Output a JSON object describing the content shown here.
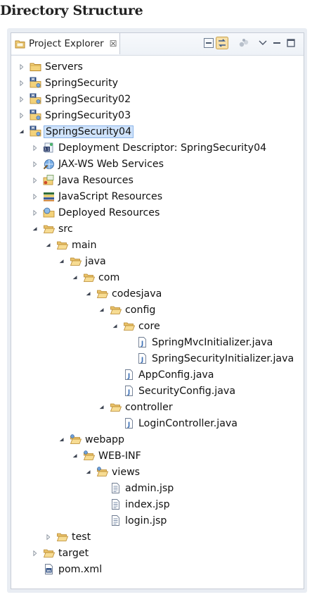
{
  "heading": "Directory Structure",
  "view": {
    "tab_label": "Project Explorer",
    "close_glyph": "☒"
  },
  "tree": [
    {
      "depth": 0,
      "label": "Servers",
      "icon": "folder-icon",
      "twisty": "collapsed"
    },
    {
      "depth": 0,
      "label": "SpringSecurity",
      "icon": "maven-web-project-icon",
      "twisty": "collapsed"
    },
    {
      "depth": 0,
      "label": "SpringSecurity02",
      "icon": "maven-web-project-icon",
      "twisty": "collapsed"
    },
    {
      "depth": 0,
      "label": "SpringSecurity03",
      "icon": "maven-web-project-icon",
      "twisty": "collapsed"
    },
    {
      "depth": 0,
      "label": "SpringSecurity04",
      "icon": "maven-web-project-icon",
      "twisty": "expanded",
      "selected": true
    },
    {
      "depth": 1,
      "label": "Deployment Descriptor: SpringSecurity04",
      "icon": "deployment-descriptor-icon",
      "twisty": "collapsed"
    },
    {
      "depth": 1,
      "label": "JAX-WS Web Services",
      "icon": "web-services-icon",
      "twisty": "collapsed"
    },
    {
      "depth": 1,
      "label": "Java Resources",
      "icon": "java-resources-icon",
      "twisty": "collapsed"
    },
    {
      "depth": 1,
      "label": "JavaScript Resources",
      "icon": "javascript-resources-icon",
      "twisty": "collapsed"
    },
    {
      "depth": 1,
      "label": "Deployed Resources",
      "icon": "deployed-resources-icon",
      "twisty": "collapsed"
    },
    {
      "depth": 1,
      "label": "src",
      "icon": "open-folder-icon",
      "twisty": "expanded"
    },
    {
      "depth": 2,
      "label": "main",
      "icon": "open-folder-icon",
      "twisty": "expanded"
    },
    {
      "depth": 3,
      "label": "java",
      "icon": "open-folder-icon",
      "twisty": "expanded"
    },
    {
      "depth": 4,
      "label": "com",
      "icon": "open-folder-icon",
      "twisty": "expanded"
    },
    {
      "depth": 5,
      "label": "codesjava",
      "icon": "open-folder-icon",
      "twisty": "expanded"
    },
    {
      "depth": 6,
      "label": "config",
      "icon": "open-folder-icon",
      "twisty": "expanded"
    },
    {
      "depth": 7,
      "label": "core",
      "icon": "open-folder-icon",
      "twisty": "expanded"
    },
    {
      "depth": 8,
      "label": "SpringMvcInitializer.java",
      "icon": "java-file-icon",
      "twisty": "none"
    },
    {
      "depth": 8,
      "label": "SpringSecurityInitializer.java",
      "icon": "java-file-icon",
      "twisty": "none"
    },
    {
      "depth": 7,
      "label": "AppConfig.java",
      "icon": "java-file-icon",
      "twisty": "none"
    },
    {
      "depth": 7,
      "label": "SecurityConfig.java",
      "icon": "java-file-icon",
      "twisty": "none"
    },
    {
      "depth": 6,
      "label": "controller",
      "icon": "open-folder-icon",
      "twisty": "expanded"
    },
    {
      "depth": 7,
      "label": "LoginController.java",
      "icon": "java-file-icon",
      "twisty": "none"
    },
    {
      "depth": 3,
      "label": "webapp",
      "icon": "open-web-folder-icon",
      "twisty": "expanded"
    },
    {
      "depth": 4,
      "label": "WEB-INF",
      "icon": "open-web-folder-icon",
      "twisty": "expanded"
    },
    {
      "depth": 5,
      "label": "views",
      "icon": "open-web-folder-icon",
      "twisty": "expanded"
    },
    {
      "depth": 6,
      "label": "admin.jsp",
      "icon": "jsp-file-icon",
      "twisty": "none"
    },
    {
      "depth": 6,
      "label": "index.jsp",
      "icon": "jsp-file-icon",
      "twisty": "none"
    },
    {
      "depth": 6,
      "label": "login.jsp",
      "icon": "jsp-file-icon",
      "twisty": "none"
    },
    {
      "depth": 2,
      "label": "test",
      "icon": "open-folder-icon",
      "twisty": "collapsed"
    },
    {
      "depth": 1,
      "label": "target",
      "icon": "open-folder-icon",
      "twisty": "collapsed"
    },
    {
      "depth": 1,
      "label": "pom.xml",
      "icon": "maven-pom-icon",
      "twisty": "none"
    }
  ],
  "colors": {
    "folder": "#e9c26b",
    "folder_dark": "#b8862a",
    "selection": "#cfe3fb",
    "selection_border": "#8ab4e8",
    "java_blue": "#3b6fb6"
  }
}
